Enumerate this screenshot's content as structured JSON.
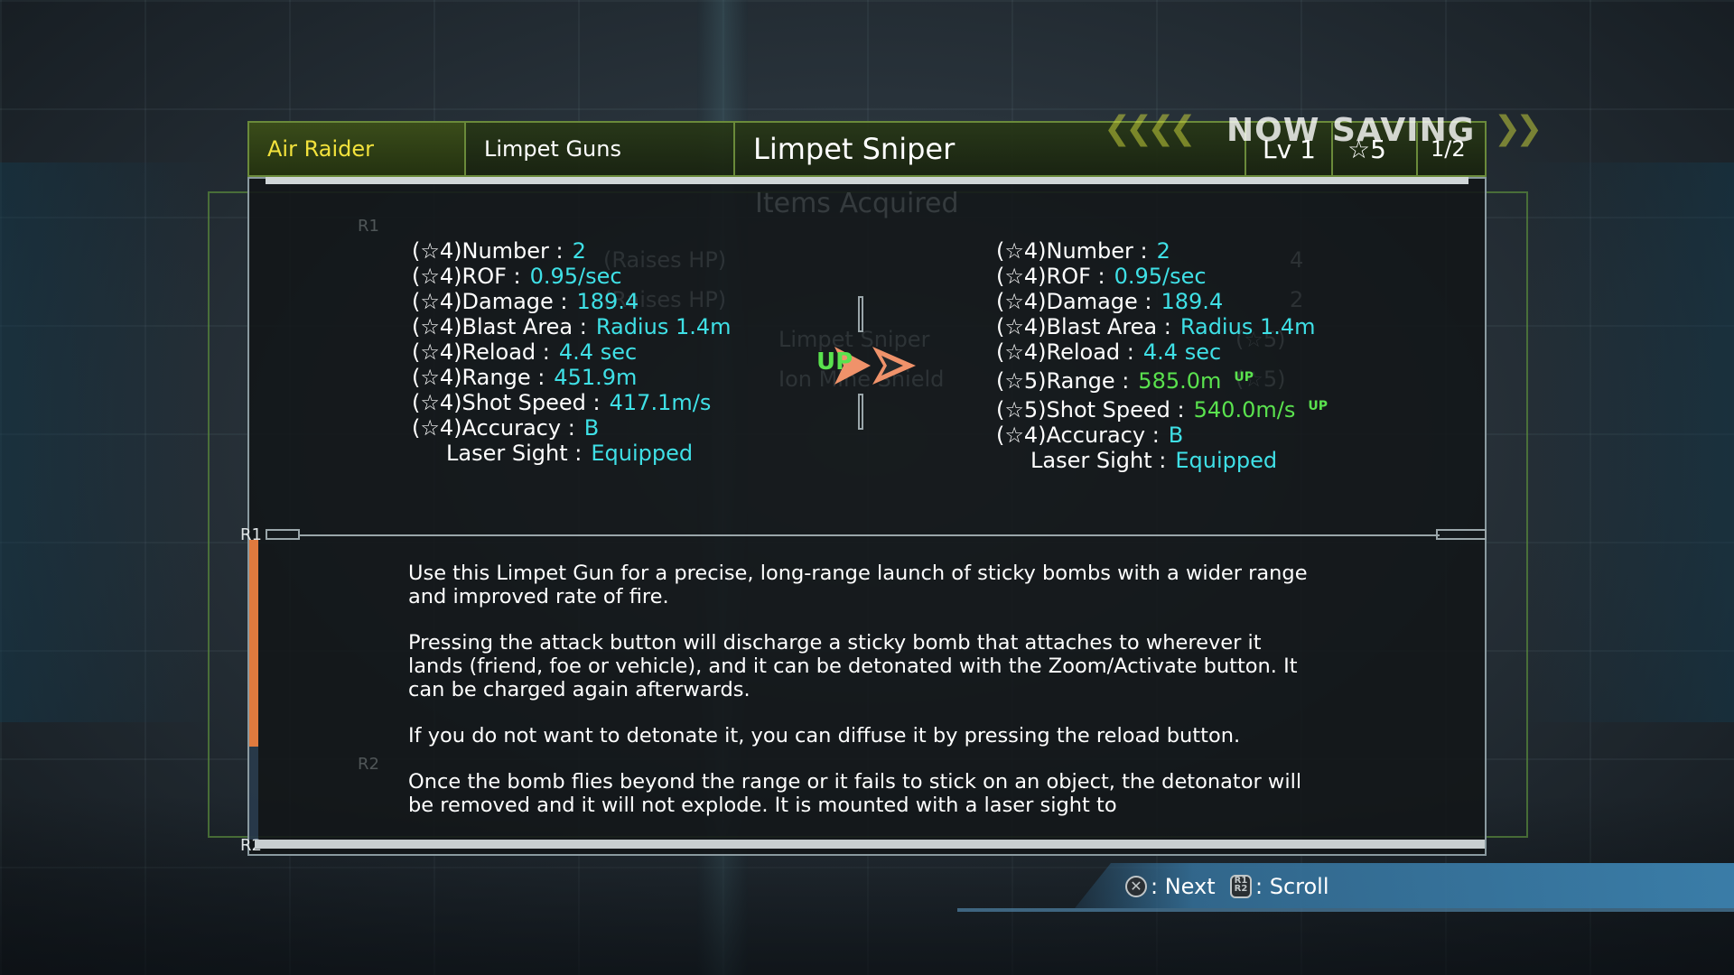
{
  "header": {
    "class_name": "Air Raider",
    "category": "Limpet Guns",
    "weapon_name": "Limpet Sniper",
    "level": "Lv 1",
    "stars": "☆5",
    "page": "1/2",
    "saving_text": "NOW SAVING"
  },
  "background_panel": {
    "title": "Items Acquired",
    "lines": [
      "(Raises HP)",
      "(Raises HP)",
      "Limpet Sniper",
      "Ion Mine Shield",
      "4",
      "2",
      "(☆5)",
      "(☆5)"
    ]
  },
  "stats_current": [
    {
      "label": "(☆4)Number :",
      "value": "2"
    },
    {
      "label": "(☆4)ROF :",
      "value": "0.95/sec"
    },
    {
      "label": "(☆4)Damage :",
      "value": "189.4"
    },
    {
      "label": "(☆4)Blast Area :",
      "value": "Radius 1.4m"
    },
    {
      "label": "(☆4)Reload :",
      "value": "4.4 sec"
    },
    {
      "label": "(☆4)Range :",
      "value": "451.9m"
    },
    {
      "label": "(☆4)Shot Speed :",
      "value": "417.1m/s"
    },
    {
      "label": "(☆4)Accuracy :",
      "value": "B"
    },
    {
      "label": "Laser Sight :",
      "value": "Equipped"
    }
  ],
  "stats_new": [
    {
      "label": "(☆4)Number :",
      "value": "2",
      "tag": ""
    },
    {
      "label": "(☆4)ROF :",
      "value": "0.95/sec",
      "tag": ""
    },
    {
      "label": "(☆4)Damage :",
      "value": "189.4",
      "tag": ""
    },
    {
      "label": "(☆4)Blast Area :",
      "value": "Radius 1.4m",
      "tag": ""
    },
    {
      "label": "(☆4)Reload :",
      "value": "4.4 sec",
      "tag": ""
    },
    {
      "label": "(☆5)Range :",
      "value": "585.0m",
      "tag": "UP"
    },
    {
      "label": "(☆5)Shot Speed :",
      "value": "540.0m/s",
      "tag": "UP"
    },
    {
      "label": "(☆4)Accuracy :",
      "value": "B",
      "tag": ""
    },
    {
      "label": "Laser Sight :",
      "value": "Equipped",
      "tag": ""
    }
  ],
  "upgrade_indicator": "UP",
  "shoulder_labels": {
    "r1_top": "R1",
    "r1": "R1",
    "r2_mid": "R2",
    "r2": "R2"
  },
  "description": [
    "Use this Limpet Gun for a precise, long-range launch of sticky bombs with a wider range and improved rate of fire.",
    "Pressing the attack button will discharge a sticky bomb that attaches to wherever it lands (friend, foe or vehicle), and it can be detonated with the Zoom/Activate button. It can be charged again afterwards.",
    "If you do not want to detonate it, you can diffuse it by pressing the reload button.",
    "Once the bomb flies beyond the range or it fails to stick on an object, the detonator will be removed and it will not explode. It is mounted with a laser sight to"
  ],
  "scroll": {
    "thumb_fraction": 0.69
  },
  "footer": {
    "next_label": ": Next",
    "scroll_label": ": Scroll",
    "next_icon": "cross-button-icon",
    "scroll_icon": "r1-r2-button-icon"
  },
  "colors": {
    "value_cyan": "#3fe0e6",
    "up_green": "#5ae24e",
    "class_yellow": "#f2e23c",
    "arrow_orange": "#f0926a",
    "scroll_orange": "#e07a3e",
    "header_green": "#6a8a3a"
  }
}
